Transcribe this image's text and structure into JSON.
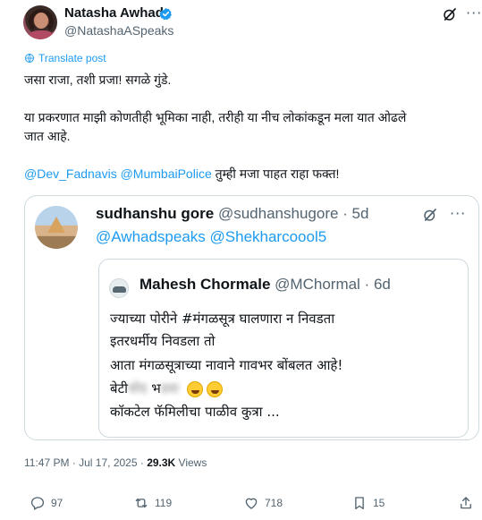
{
  "author": {
    "display_name": "Natasha Awhad",
    "handle": "@NatashaASpeaks",
    "verified_color": "#1d9bf0"
  },
  "translate_label": "Translate post",
  "post": {
    "line1": "जसा राजा, तशी प्रजा! सगळे गुंडे.",
    "line2": "या प्रकरणात माझी कोणतीही भूमिका नाही, तरीही या नीच लोकांकडून मला यात ओढले",
    "line3": "जात आहे.",
    "mention1": "@Dev_Fadnavis",
    "mention2": "@MumbaiPolice",
    "line4_tail": "तुम्ही मजा पाहत राहा फक्त!"
  },
  "quote": {
    "display_name": "sudhanshu gore",
    "handle_time": "@sudhanshugore · 5d",
    "mentions": "@Awhadspeaks @Shekharcoool5",
    "inner": {
      "display_name": "Mahesh Chormale",
      "handle_time": "@MChormal · 6d",
      "line1": "ज्याच्या पोरीने #मंगळसूत्र घालणारा न निवडता",
      "line2": "इतरधर्मीय निवडला तो",
      "line3": "आता मंगळसूत्राच्या नावाने गावभर बोंबलत आहे!",
      "line4_start": "बेटी",
      "line4_blur1": "चोद",
      "line4_mid": "भ",
      "line4_blur2": "डवा",
      "line5": "कॉकटेल फॅमिलीचा पाळीव कुत्रा ..."
    }
  },
  "meta": {
    "time": "11:47 PM · Jul 17, 2025 · ",
    "views_count": "29.3K",
    "views_label": " Views"
  },
  "actions": {
    "replies": "97",
    "reposts": "119",
    "likes": "718",
    "bookmarks": "15"
  },
  "colors": {
    "accent": "#1d9bf0",
    "muted": "#536471",
    "border": "#cfd9de"
  }
}
